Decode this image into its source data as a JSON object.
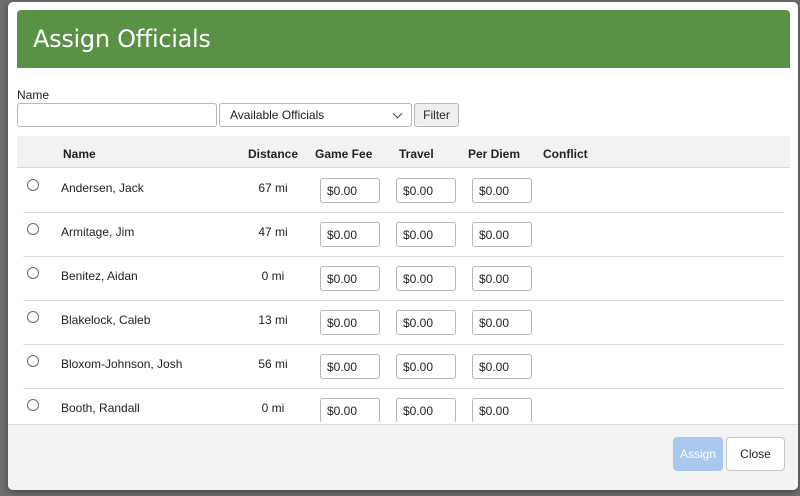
{
  "modal": {
    "title": "Assign Officials",
    "header_color": "#5a9245"
  },
  "filters": {
    "name_label": "Name",
    "name_value": "",
    "status_selected": "Available Officials",
    "filter_label": "Filter"
  },
  "table": {
    "headers": {
      "name": "Name",
      "distance": "Distance",
      "game_fee": "Game Fee",
      "travel": "Travel",
      "per_diem": "Per Diem",
      "conflict": "Conflict"
    },
    "rows": [
      {
        "name": "Andersen, Jack",
        "distance": "67 mi",
        "game_fee": "$0.00",
        "travel": "$0.00",
        "per_diem": "$0.00",
        "conflict": ""
      },
      {
        "name": "Armitage, Jim",
        "distance": "47 mi",
        "game_fee": "$0.00",
        "travel": "$0.00",
        "per_diem": "$0.00",
        "conflict": ""
      },
      {
        "name": "Benitez, Aidan",
        "distance": "0 mi",
        "game_fee": "$0.00",
        "travel": "$0.00",
        "per_diem": "$0.00",
        "conflict": ""
      },
      {
        "name": "Blakelock, Caleb",
        "distance": "13 mi",
        "game_fee": "$0.00",
        "travel": "$0.00",
        "per_diem": "$0.00",
        "conflict": ""
      },
      {
        "name": "Bloxom-Johnson, Josh",
        "distance": "56 mi",
        "game_fee": "$0.00",
        "travel": "$0.00",
        "per_diem": "$0.00",
        "conflict": ""
      },
      {
        "name": "Booth, Randall",
        "distance": "0 mi",
        "game_fee": "$0.00",
        "travel": "$0.00",
        "per_diem": "$0.00",
        "conflict": ""
      }
    ]
  },
  "footer": {
    "assign_label": "Assign",
    "close_label": "Close",
    "assign_color": "#a9c8ee"
  }
}
